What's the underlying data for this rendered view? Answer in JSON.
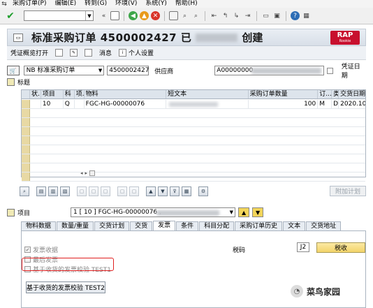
{
  "menu": {
    "logo": "⇆",
    "items": [
      "采购订单(P)",
      "编辑(E)",
      "转到(G)",
      "环境(V)",
      "系统(Y)",
      "帮助(H)"
    ]
  },
  "title": {
    "text": "标准采购订单 4500002427 已",
    "suffix": "创建",
    "rap_line1": "RAP",
    "rap_line2": "Rookie"
  },
  "app_toolbar": {
    "doc_overview": "凭证概览打开",
    "messages": "消息",
    "personal_settings": "个人设置"
  },
  "header": {
    "doc_type": "NB 标准采购订单",
    "po_number": "4500002427",
    "vendor_label": "供应商",
    "vendor_value": "A00000000",
    "doc_date_label": "凭证日期"
  },
  "sections": {
    "header_label": "标题",
    "item_overview_label": "标题"
  },
  "grid": {
    "headers": [
      "状.",
      "项目",
      "科",
      "项.",
      "物料",
      "短文本",
      "采购订单数量",
      "订...",
      "类",
      "交货日期"
    ],
    "rows": [
      {
        "status": "",
        "item": "10",
        "acct": "Q",
        "cat": "",
        "material": "FGC-HG-00000076",
        "short_text": "",
        "qty": "100",
        "unit": "M",
        "type": "D",
        "date": "2020.10"
      }
    ],
    "empty_rows": 8,
    "scroll_left": "◂",
    "scroll_right": "▸"
  },
  "grid_toolbar": {
    "icons": [
      "detail-icon",
      "copy-icon",
      "expand-icon",
      "collapse-icon",
      "delete-icon",
      "insert-icon",
      "paste-icon",
      "cut-icon",
      "sort-asc-icon",
      "filter-icon",
      "filter-icon",
      "sum-icon",
      "settings-icon"
    ],
    "addl_planning": "附加计划"
  },
  "item_detail": {
    "label": "项目",
    "selection": "1 [ 10 ] FGC-HG-00000076 ,",
    "tabs": [
      "物料数据",
      "数量/重量",
      "交货计划",
      "交货",
      "发票",
      "条件",
      "科目分配",
      "采购订单历史",
      "文本",
      "交货地址"
    ],
    "active_tab": 4,
    "inv_receipt": "发票收据",
    "final_invoice": "最后发票",
    "gr_based_iv": "基于收货的发票校验 TEST1",
    "tax_code_label": "税码",
    "tax_code_value": "J2",
    "taxes_button": "税收",
    "gr2_button": "基于收货的发票校验 TEST2"
  },
  "watermark": {
    "text": "菜鸟家园"
  }
}
